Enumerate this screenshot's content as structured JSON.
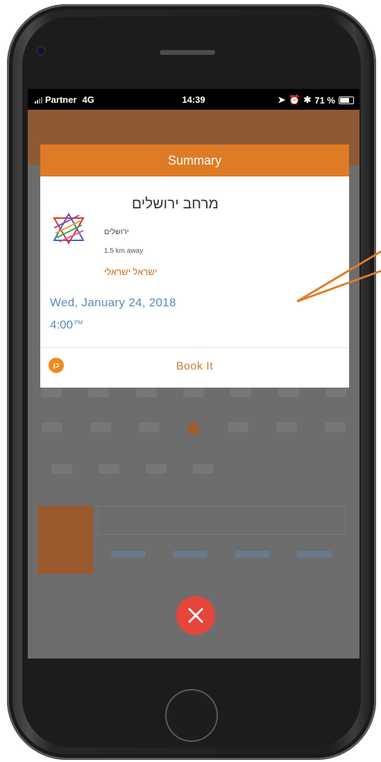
{
  "status_bar": {
    "carrier": "Partner",
    "network": "4G",
    "time": "14:39",
    "battery": "71 %"
  },
  "modal": {
    "title": "Summary",
    "venue_name": "מרחב ירושלים",
    "venue_city": "ירושלים",
    "venue_distance": "1.5 km away",
    "venue_type": "ישראל ישראלי",
    "date": "Wed, January 24, 2018",
    "time": "4:00",
    "time_suffix": "PM",
    "thumb_icon_text": "כן",
    "book_label": "Book It"
  },
  "icons": {
    "close": "close-icon",
    "thumb": "thumb-icon",
    "logo": "venue-logo"
  },
  "colors": {
    "accent": "#e07b25",
    "date_text": "#5b8ab8",
    "close": "#e6453c"
  }
}
